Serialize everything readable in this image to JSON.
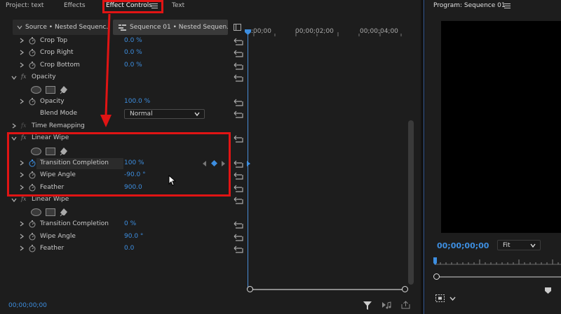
{
  "tabs": {
    "project": "Project: text",
    "effects": "Effects",
    "effect_controls": "Effect Controls",
    "text": "Text"
  },
  "source": {
    "source_label": "Source • Nested Sequenc...",
    "sequence_label": "Sequence 01 • Nested Sequen..."
  },
  "timeline": {
    "ticks": [
      ":00;00",
      "00;00;02;00",
      "00;00;04;00"
    ]
  },
  "effects": {
    "crop_top": {
      "label": "Crop Top",
      "value": "0.0 %"
    },
    "crop_right": {
      "label": "Crop Right",
      "value": "0.0 %"
    },
    "crop_bottom": {
      "label": "Crop Bottom",
      "value": "0.0 %"
    },
    "opacity_header": "Opacity",
    "opacity": {
      "label": "Opacity",
      "value": "100.0 %"
    },
    "blend_mode": {
      "label": "Blend Mode",
      "value": "Normal"
    },
    "time_remapping": "Time Remapping",
    "linear_wipe_1": {
      "header": "Linear Wipe",
      "transition": {
        "label": "Transition Completion",
        "value": "100 %"
      },
      "angle": {
        "label": "Wipe Angle",
        "value": "-90.0 °"
      },
      "feather": {
        "label": "Feather",
        "value": "900.0"
      }
    },
    "linear_wipe_2": {
      "header": "Linear Wipe",
      "transition": {
        "label": "Transition Completion",
        "value": "0 %"
      },
      "angle": {
        "label": "Wipe Angle",
        "value": "90.0 °"
      },
      "feather": {
        "label": "Feather",
        "value": "0.0"
      }
    }
  },
  "footer": {
    "timecode": "00;00;00;00"
  },
  "program": {
    "title": "Program: Sequence 01",
    "timecode": "00;00;00;00",
    "fit": "Fit"
  },
  "colors": {
    "accent": "#3d8ee0",
    "highlight": "#e01414",
    "panel": "#1d1d1d"
  }
}
